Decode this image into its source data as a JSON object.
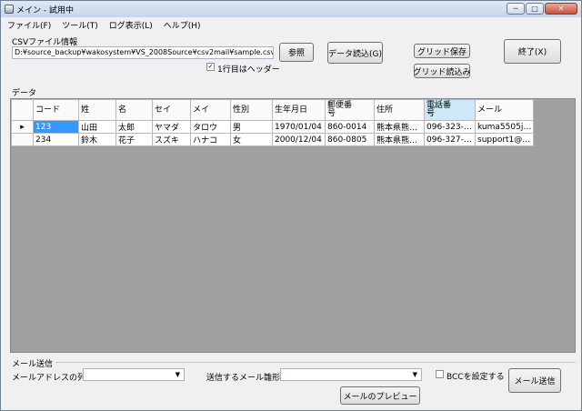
{
  "window": {
    "title": "メイン - 試用中"
  },
  "menu": [
    "ファイル(F)",
    "ツール(T)",
    "ログ表示(L)",
    "ヘルプ(H)"
  ],
  "csv": {
    "group_label": "CSVファイル情報",
    "path_value": "D:¥source_backup¥wakosystem¥VS_2008Source¥csv2mail¥sample.csv",
    "browse_label": "参照",
    "load_label": "データ読込(G)",
    "header_checkbox_label": "1行目はヘッダー",
    "header_checked": true
  },
  "grid_buttons": {
    "save_label": "グリッド保存",
    "load_label": "グリッド読込み"
  },
  "exit_label": "終了(X)",
  "data_section_label": "データ",
  "table": {
    "columns": [
      "コード",
      "姓",
      "名",
      "セイ",
      "メイ",
      "性別",
      "生年月日",
      "郵便番\n号",
      "住所",
      "電話番\n号",
      "メール"
    ],
    "rows": [
      [
        "123",
        "山田",
        "太郎",
        "ヤマダ",
        "タロウ",
        "男",
        "1970/01/04",
        "860-0014",
        "熊本県熊…",
        "096-323-…",
        "kuma5505j…"
      ],
      [
        "234",
        "鈴木",
        "花子",
        "スズキ",
        "ハナコ",
        "女",
        "2000/12/04",
        "860-0805",
        "熊本県熊…",
        "096-327-…",
        "support1@…"
      ]
    ]
  },
  "mail": {
    "group_label": "メール送信",
    "address_column_label": "メールアドレスの列は",
    "address_column_value": "",
    "template_label": "送信するメール雛形",
    "template_value": "",
    "bcc_label": "BCCを設定する",
    "bcc_checked": false,
    "preview_label": "メールのプレビュー",
    "send_label": "メール送信"
  }
}
